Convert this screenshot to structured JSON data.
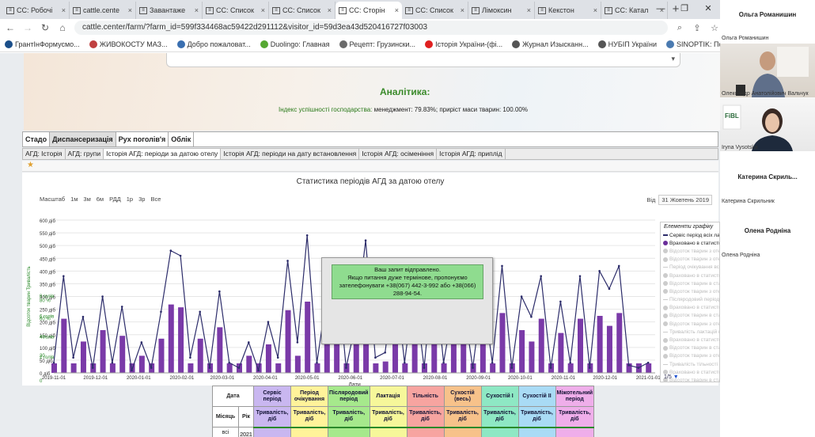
{
  "browser": {
    "tabs": [
      {
        "label": "CC: Робочі"
      },
      {
        "label": "cattle.cente"
      },
      {
        "label": "Завантаже"
      },
      {
        "label": "CC: Список"
      },
      {
        "label": "CC: Список"
      },
      {
        "label": "CC: Сторін"
      },
      {
        "label": "CC: Список"
      },
      {
        "label": "Лімоксин"
      },
      {
        "label": "Кекстон"
      },
      {
        "label": "CC: Катал"
      }
    ],
    "active_tab": 5,
    "url": "cattle.center/farm/?farm_id=599f334468ac59422d291112&visitor_id=59d3ea43d520416727f03003",
    "bookmarks": [
      "ГрантІнФормусмо...",
      "ЖИВОКОСТУ МАЗ...",
      "Добро пожаловат...",
      "Duolingo: Главная",
      "Рецепт: Грузински...",
      "Історія України-(фі...",
      "Журнал Изысканн...",
      "НУБІП України",
      "SINOPTIK: Погода..."
    ]
  },
  "analytics": {
    "title": "Аналітика:",
    "index_label": "Індекс успішності господарства:",
    "index_values": " менеджмент: 79.83%; приріст маси тварин: 100.00%"
  },
  "main_tabs": [
    "Стадо",
    "Диспансеризація",
    "Рух поголів'я",
    "Облік"
  ],
  "sub_tabs": [
    "АГД: Історія",
    "АГД: групи",
    "Історія АГД: періоди за датою отелу",
    "Історія АГД: періоди на дату встановлення",
    "Історія АГД: осіменіння",
    "Історія АГД: приплід"
  ],
  "chart": {
    "title": "Статистика періодів АГД за датою отелу",
    "zoom_label": "Масштаб",
    "zoom_options": [
      "1м",
      "3м",
      "6м",
      "РДД",
      "1р",
      "3р",
      "Все"
    ],
    "from_label": "Від",
    "from_date": "31 Жовтень 2019",
    "xlabel": "Дати",
    "ylabel_left": "Відсоток тварин",
    "ylabel_right": "Тривалість",
    "navigator_labels": [
      "Лист... '21",
      "Лист... '21",
      "Трав. '21"
    ],
    "legend_title": "Елементи графіку",
    "legend_items": [
      "Сервіс період всіх лакт",
      "Враховано в статистику",
      "Відсоток тварин з отелами з",
      "Відсоток тварин з отелами за сервіс період",
      "Період очікування всіх лактацій",
      "Враховано в статистику по періоду о",
      "Відсоток тварин в статистиці по періоду о",
      "Відсоток тварин з отелами за період очікув",
      "Післяродовий період всіх лактацій",
      "Враховано в статистику по післяродову",
      "Відсоток тварин в статистиці по післяр",
      "Відсоток тварин з отелами по післяр",
      "Тривалість лактацій всіх лактацій",
      "Враховано в статистику по тривалос",
      "Відсоток тварин в статистиці по трив",
      "Відсоток тварин з отелами по тривал",
      "Тривалість тільності всіх лактацій",
      "Враховано в статистику по тривалос",
      "Відсоток тварин в статистиці по трив",
      "Відсоток тварин з отелами по трива"
    ],
    "legend_pager": "1/5",
    "credit": "https://cattle.cen"
  },
  "chart_data": {
    "type": "line",
    "title": "Статистика періодів АГД за датою отелу",
    "xlabel": "Дати",
    "ylabel": "Відсоток тварин / Тривалість",
    "x_ticks": [
      "2019-11-01",
      "2019-12-01",
      "2020-01-01",
      "2020-02-01",
      "2020-03-01",
      "2020-04-01",
      "2020-05-01",
      "2020-06-01",
      "2020-07-01",
      "2020-08-01",
      "2020-09-01",
      "2020-10-01",
      "2020-11-01",
      "2020-12-01",
      "2021-01-01"
    ],
    "y_ticks_days": [
      "0 діб",
      "50 діб",
      "100 діб",
      "150 діб",
      "200 діб",
      "250 діб",
      "300 діб",
      "350 діб",
      "400 діб",
      "450 діб",
      "500 діб",
      "550 діб",
      "600 діб"
    ],
    "y_ticks_percent": [
      "0",
      "20",
      "40",
      "60 %",
      "80 %"
    ],
    "y_ticks_heads": [
      "2 голів",
      "4 голів",
      "6 голів",
      "8 голів"
    ],
    "ylim": [
      0,
      600
    ],
    "series": [
      {
        "name": "Сервіс період всіх лакт",
        "type": "line",
        "color": "#2c2c6a",
        "x": [
          "2019-11-01",
          "2019-11-08",
          "2019-11-15",
          "2019-11-22",
          "2019-11-29",
          "2019-12-06",
          "2019-12-13",
          "2019-12-20",
          "2019-12-27",
          "2020-01-03",
          "2020-01-10",
          "2020-01-17",
          "2020-01-24",
          "2020-01-31",
          "2020-02-07",
          "2020-02-14",
          "2020-02-21",
          "2020-02-28",
          "2020-03-06",
          "2020-03-13",
          "2020-03-20",
          "2020-03-27",
          "2020-04-03",
          "2020-04-10",
          "2020-04-17",
          "2020-04-24",
          "2020-05-01",
          "2020-05-08",
          "2020-05-15",
          "2020-05-22",
          "2020-05-29",
          "2020-06-05",
          "2020-06-12",
          "2020-06-19",
          "2020-06-26",
          "2020-07-03",
          "2020-07-10",
          "2020-07-17",
          "2020-07-24",
          "2020-07-31",
          "2020-08-07",
          "2020-08-14",
          "2020-08-21",
          "2020-08-28",
          "2020-09-04",
          "2020-09-11",
          "2020-09-18",
          "2020-09-25",
          "2020-10-02",
          "2020-10-09",
          "2020-10-16",
          "2020-10-23",
          "2020-10-30",
          "2020-11-06",
          "2020-11-13",
          "2020-11-20",
          "2020-11-27",
          "2020-12-04",
          "2020-12-11",
          "2020-12-18",
          "2020-12-25",
          "2021-01-01"
        ],
        "values": [
          40,
          380,
          60,
          220,
          20,
          300,
          40,
          260,
          10,
          120,
          20,
          240,
          480,
          460,
          60,
          240,
          20,
          320,
          40,
          20,
          120,
          10,
          200,
          60,
          440,
          120,
          540,
          40,
          300,
          440,
          20,
          200,
          520,
          60,
          80,
          380,
          40,
          340,
          20,
          420,
          40,
          260,
          280,
          20,
          320,
          40,
          420,
          20,
          300,
          220,
          380,
          20,
          280,
          40,
          380,
          20,
          400,
          330,
          420,
          30,
          20,
          40
        ]
      }
    ]
  },
  "popup": {
    "line1": "Ваш запит відправлено.",
    "line2": "Якщо питання дуже термінове, пропонуємо",
    "line3": "зателефонувати +38(067) 442-3-992 або +38(066)",
    "line4": "288-94-54."
  },
  "table": {
    "date_header": "Дата",
    "month_header": "Місяць",
    "year_header": "Рік",
    "columns": [
      {
        "name": "Сервіс період",
        "unit": "Тривалість, діб",
        "color": "#c9b7f0"
      },
      {
        "name": "Період очікування",
        "unit": "Тривалість, діб",
        "color": "#fff39a"
      },
      {
        "name": "Післяродовий період",
        "unit": "Тривалість, діб",
        "color": "#a6e98c"
      },
      {
        "name": "Лактація",
        "unit": "Тривалість, діб",
        "color": "#f6f79a"
      },
      {
        "name": "Тільність",
        "unit": "Тривалість, діб",
        "color": "#f7a4a0"
      },
      {
        "name": "Сухостій (весь)",
        "unit": "Тривалість, діб",
        "color": "#f7c28a"
      },
      {
        "name": "Сухостій I",
        "unit": "Тривалість, діб",
        "color": "#8ee8c4"
      },
      {
        "name": "Сухостій II",
        "unit": "Тривалість, діб",
        "color": "#a9dbf5"
      },
      {
        "name": "Міжотельний період",
        "unit": "Тривалість, діб",
        "color": "#efaeea"
      }
    ],
    "month_value": "всі",
    "year_value": "2021"
  },
  "participants": [
    {
      "name": "Ольга Романишин",
      "top": "Ольга Романишин"
    },
    {
      "name": "Олександр Анатолійович Вальчук"
    },
    {
      "name": "Iryna Vysotska"
    },
    {
      "name": "Катерина Скрильник",
      "big": "Катерина  Скриль..."
    },
    {
      "name": "Олена Родніна",
      "big": "Олена Родніна"
    }
  ]
}
